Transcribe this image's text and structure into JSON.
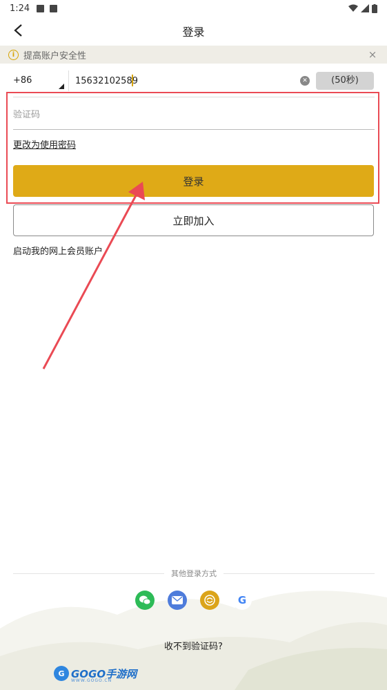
{
  "status_bar": {
    "time": "1:24"
  },
  "header": {
    "title": "登录"
  },
  "notice": {
    "text": "提高账户安全性",
    "close": "×"
  },
  "phone": {
    "country_code": "+86",
    "number": "15632102589",
    "resend_label": "(50秒)"
  },
  "code": {
    "placeholder": "验证码"
  },
  "links": {
    "switch_to_password": "更改为使用密码"
  },
  "buttons": {
    "login": "登录",
    "join": "立即加入"
  },
  "join_hint": "启动我的网上会员账户",
  "other_login": {
    "label": "其他登录方式",
    "providers": [
      "wechat-icon",
      "mail-icon",
      "yellow-circle-icon",
      "google-icon"
    ]
  },
  "no_code": "收不到验证码?",
  "watermark": {
    "text": "GOGO手游网",
    "badge": "G",
    "sub": "WWW.GOGO.CN"
  },
  "colors": {
    "accent": "#dfaa17",
    "highlight": "#ea4a54",
    "notice_bg": "#efede6"
  }
}
